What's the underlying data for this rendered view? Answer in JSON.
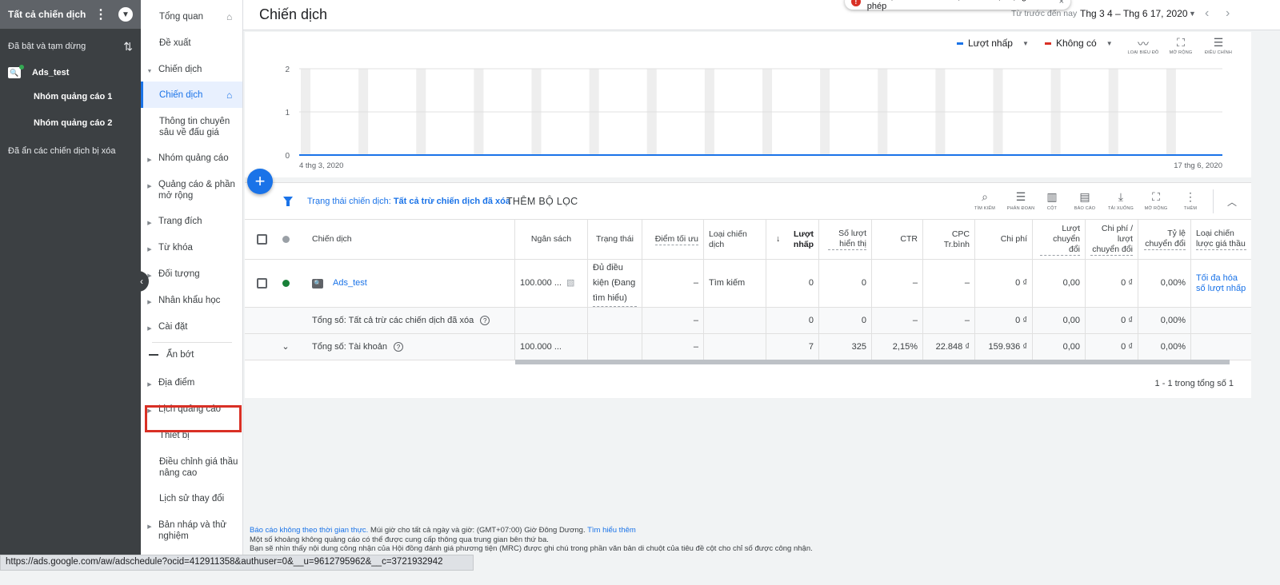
{
  "toast": {
    "text": "Bảo vệ tài khoản của bạn khỏi hoạt động trái phép",
    "close": "×"
  },
  "leftnav": {
    "title": "Tất cả chiến dịch",
    "section": "Đã bật và tạm dừng",
    "account": "Ads_test",
    "ad_groups": [
      "Nhóm quảng cáo 1",
      "Nhóm quảng cáo 2"
    ],
    "removed": "Đã ẩn các chiến dịch bị xóa"
  },
  "pagemenu": {
    "items": [
      "Tổng quan",
      "Đề xuất",
      "Chiến dịch",
      "Chiến dịch",
      "Thông tin chuyên sâu về đấu giá",
      "Nhóm quảng cáo",
      "Quảng cáo & phần mở rộng",
      "Trang đích",
      "Từ khóa",
      "Đối tượng",
      "Nhân khẩu học",
      "Cài đặt",
      "Ẩn bớt",
      "Địa điểm",
      "Lịch quảng cáo",
      "Thiết bị",
      "Điều chỉnh giá thầu nâng cao",
      "Lịch sử thay đổi",
      "Bản nháp và thử nghiệm"
    ]
  },
  "header": {
    "title": "Chiến dịch",
    "range_label": "Từ trước đến nay",
    "range": "Thg 3 4 – Thg 6 17, 2020"
  },
  "chart": {
    "metric1": "Lượt nhấp",
    "metric2": "Không có",
    "metric1_color": "#1a73e8",
    "metric2_color": "#d93025",
    "tools": [
      "LOẠI BIỂU ĐỒ",
      "MỞ RỘNG",
      "ĐIỀU CHỈNH"
    ]
  },
  "chart_data": {
    "type": "line",
    "x_start": "4 thg 3, 2020",
    "x_end": "17 thg 6, 2020",
    "y_ticks": [
      "2",
      "1",
      "0"
    ],
    "ylim": [
      0,
      2
    ],
    "series": [
      {
        "name": "Lượt nhấp",
        "values": [
          0,
          0
        ]
      }
    ]
  },
  "filter": {
    "label": "Trạng thái chiến dịch:",
    "value": "Tất cả trừ chiến dịch đã xóa",
    "add": "THÊM BỘ LỌC"
  },
  "table_tools": [
    "TÌM KIẾM",
    "PHÂN ĐOẠN",
    "CỘT",
    "BÁO CÁO",
    "TẢI XUỐNG",
    "MỞ RỘNG",
    "THÊM"
  ],
  "table": {
    "headers": [
      "Chiến dịch",
      "Ngân sách",
      "Trạng thái",
      "Điểm tối ưu",
      "Loại chiến dịch",
      "Lượt nhấp",
      "Số lượt hiển thị",
      "CTR",
      "CPC Tr.bình",
      "Chi phí",
      "Lượt chuyển đổi",
      "Chi phí / lượt chuyển đổi",
      "Tỷ lệ chuyển đổi",
      "Loại chiến lược giá thầu"
    ],
    "row": [
      "Ads_test",
      "100.000 ...",
      "Đủ điều kiện (Đang tìm hiểu)",
      "–",
      "Tìm kiếm",
      "0",
      "0",
      "–",
      "–",
      "0 ₫",
      "0,00",
      "0 ₫",
      "0,00%",
      "Tối đa hóa số lượt nhấp"
    ],
    "total1": [
      "Tổng số: Tất cả trừ các chiến dịch đã xóa",
      "–",
      "0",
      "0",
      "–",
      "–",
      "0 ₫",
      "0,00",
      "0 ₫",
      "0,00%"
    ],
    "total2": [
      "Tổng số: Tài khoản",
      "100.000 ...",
      "–",
      "7",
      "325",
      "2,15%",
      "22.848 ₫",
      "159.936 ₫",
      "0,00",
      "0 ₫",
      "0,00%"
    ],
    "pagination": "1 - 1 trong tổng số 1"
  },
  "footer": {
    "line1_link": "Báo cáo không theo thời gian thực.",
    "line1": "Múi giờ cho tất cả ngày và giờ: (GMT+07:00) Giờ Đông Dương.",
    "line1_more": "Tìm hiểu thêm",
    "line2": "Một số khoảng không quảng cáo có thể được cung cấp thông qua trung gian bên thứ ba.",
    "line3": "Bạn sẽ nhìn thấy nội dung công nhận của Hội đồng đánh giá phương tiện (MRC) được ghi chú trong phần văn bản di chuột của tiêu đề cột cho chỉ số được công nhận."
  },
  "status_url": "https://ads.google.com/aw/adschedule?ocid=412911358&authuser=0&__u=9612795962&__c=3721932942"
}
